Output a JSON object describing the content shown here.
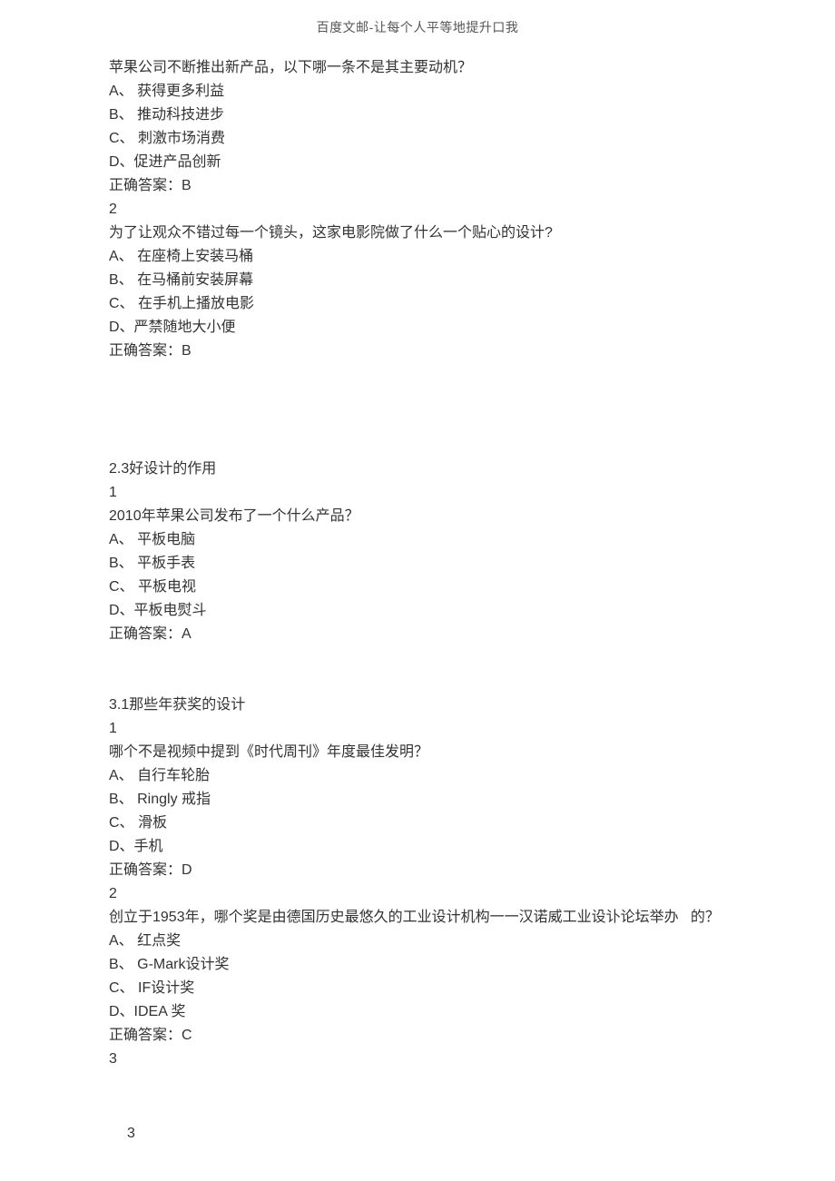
{
  "header": "百度文邮-让每个人平等地提升口我",
  "q1": {
    "prompt": "苹果公司不断推出新产品，以下哪一条不是其主要动机？",
    "a": "A、 获得更多利益",
    "b": "B、 推动科技进步",
    "c": "C、 刺激市场消费",
    "d": "D、促进产品创新",
    "answer": "正确答案：B"
  },
  "q2num": "2",
  "q2": {
    "prompt": "为了让观众不错过每一个镜头，这家电影院做了什么一个贴心的设计?",
    "a": "A、 在座椅上安装马桶",
    "b": "B、 在马桶前安装屏幕",
    "c": "C、 在手机上播放电影",
    "d": "D、严禁随地大小便",
    "answer": "正确答案：B"
  },
  "section23": "2.3好设计的作用",
  "s23num": "1",
  "q3": {
    "prompt": "2010年苹果公司发布了一个什么产品？",
    "a": "A、 平板电脑",
    "b": "B、 平板手表",
    "c": "C、 平板电视",
    "d": "D、平板电熨斗",
    "answer": "正确答案：A"
  },
  "section31": "3.1那些年获奖的设计",
  "s31num1": "1",
  "q4": {
    "prompt": "哪个不是视频中提到《时代周刊》年度最佳发明？",
    "a": "A、 自行车轮胎",
    "b": "B、 Ringly 戒指",
    "c": "C、 滑板",
    "d": "D、手机",
    "answer": "正确答案：D"
  },
  "s31num2": "2",
  "q5": {
    "prompt": "创立于1953年，哪个奖是由德国历史最悠久的工业设计机构一一汉诺威工业设讣论坛举办   的？",
    "a": "A、 红点奖",
    "b": "B、 G-Mark设计奖",
    "c": "C、 IF设计奖",
    "d": "D、IDEA 奖",
    "answer": "正确答案：C"
  },
  "s31num3": "3",
  "pageNumber": "3"
}
